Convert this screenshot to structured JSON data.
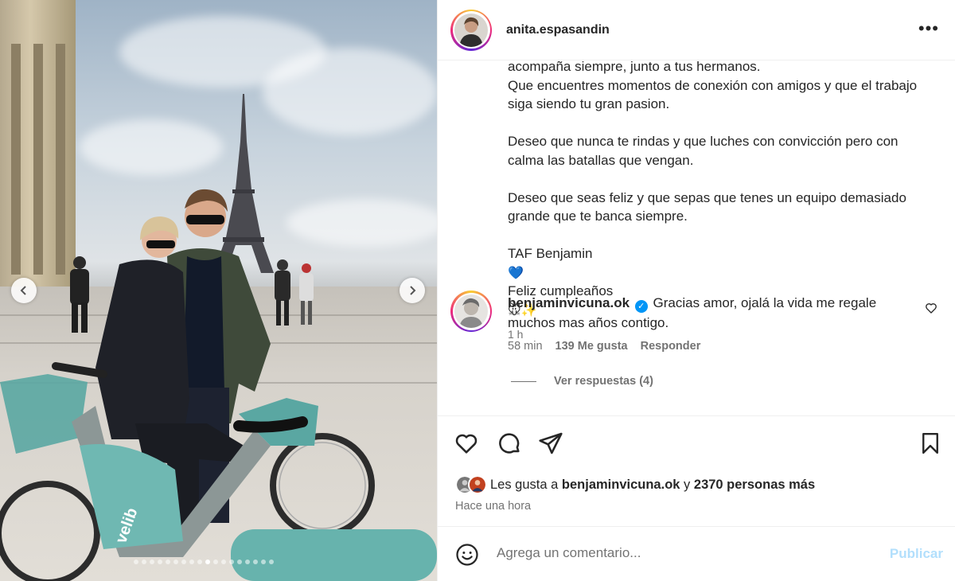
{
  "post": {
    "username": "anita.espasandin",
    "more_icon": "more-horizontal-icon"
  },
  "photo": {
    "bike_brand": "velib",
    "dots_total": 18,
    "dots_active_index": 9
  },
  "caption": {
    "line1": "acompaña siempre, junto a tus hermanos.",
    "line2": "Que encuentres momentos de conexión con amigos y que el trabajo siga siendo tu gran pasion.",
    "para2": "Deseo que nunca te rindas y que luches con convicción pero con calma las batallas que vengan.",
    "para3": "Deseo que seas feliz y que sepas que tenes un equipo demasiado grande que te banca siempre.",
    "taf_text": "TAF Benjamin",
    "heart_emoji": "💙",
    "bday_text": "Feliz cumpleaños",
    "emoji_tail": "🐭✨",
    "time": "1 h"
  },
  "comment": {
    "username": "benjaminvicuna.ok",
    "text": "Gracias amor, ojalá la vida me regale muchos mas años contigo.",
    "time": "58 min",
    "likes": "139 Me gusta",
    "reply": "Responder",
    "view_replies": "Ver respuestas (4)"
  },
  "footer": {
    "liked_prefix": "Les gusta a",
    "liked_user": "benjaminvicuna.ok",
    "liked_and": "y",
    "liked_count": "2370 personas más",
    "time_ago": "Hace una hora",
    "comment_placeholder": "Agrega un comentario...",
    "post_label": "Publicar"
  },
  "colors": {
    "link_blue": "#0095f6",
    "post_disabled": "#b2dffc",
    "muted": "#737373"
  }
}
